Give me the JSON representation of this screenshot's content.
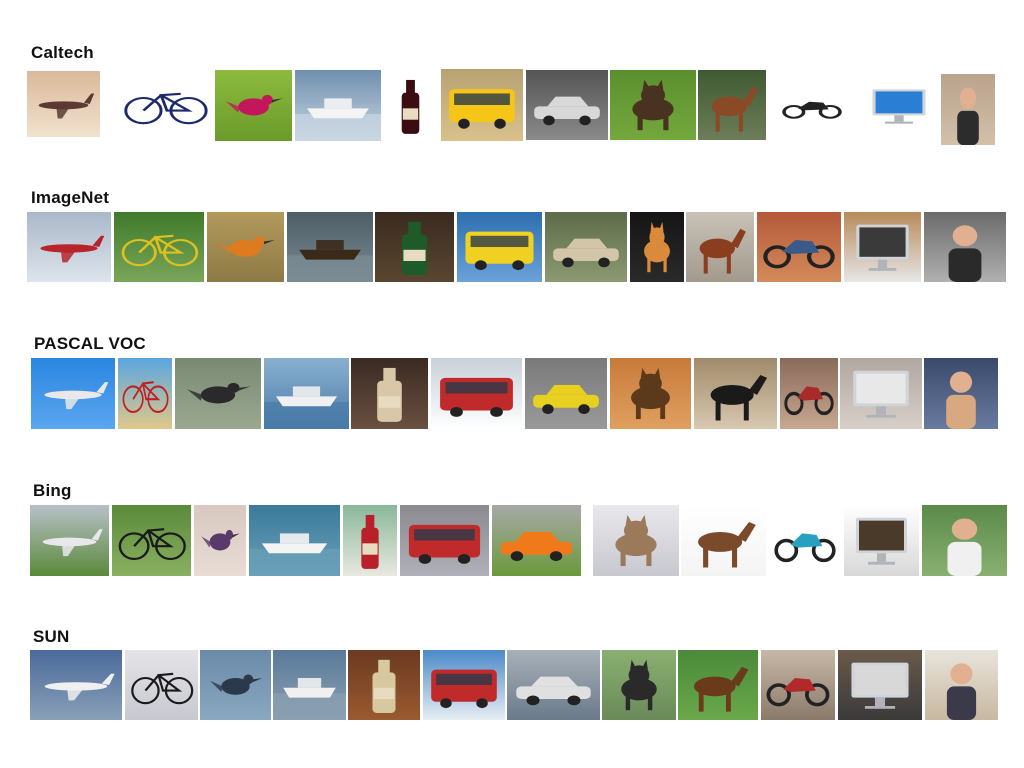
{
  "datasets": [
    {
      "name": "Caltech",
      "images": [
        {
          "subject": "airplane",
          "colors": [
            "#d9b99a",
            "#f1e2cf",
            "#5a3a32"
          ]
        },
        {
          "subject": "bicycle",
          "colors": [
            "#ffffff",
            "#ffffff",
            "#1c2a6b"
          ]
        },
        {
          "subject": "bird",
          "colors": [
            "#8dbb3e",
            "#6a9a2a",
            "#c2185b"
          ]
        },
        {
          "subject": "boat",
          "colors": [
            "#6f8fae",
            "#c9d6e2",
            "#f4f4f4"
          ]
        },
        {
          "subject": "bottle",
          "colors": [
            "#ffffff",
            "#ffffff",
            "#3b0d12"
          ]
        },
        {
          "subject": "bus",
          "colors": [
            "#b8a272",
            "#d8c18c",
            "#f5c518"
          ]
        },
        {
          "subject": "car",
          "colors": [
            "#555555",
            "#8a8a8a",
            "#d8d8d8"
          ]
        },
        {
          "subject": "dog",
          "colors": [
            "#5a8f2e",
            "#74a83d",
            "#4a3220"
          ]
        },
        {
          "subject": "horse",
          "colors": [
            "#3f5a32",
            "#6d7d58",
            "#8a4a25"
          ]
        },
        {
          "subject": "motorbike",
          "colors": [
            "#ffffff",
            "#ffffff",
            "#222222"
          ]
        },
        {
          "subject": "monitor",
          "colors": [
            "#ffffff",
            "#ffffff",
            "#2a7fd4"
          ]
        },
        {
          "subject": "person",
          "colors": [
            "#b9a38c",
            "#d2c0a8",
            "#2c2c2c"
          ]
        }
      ]
    },
    {
      "name": "ImageNet",
      "images": [
        {
          "subject": "airplane",
          "colors": [
            "#aab8c8",
            "#dde4ec",
            "#b7252b"
          ]
        },
        {
          "subject": "bicycle",
          "colors": [
            "#3f7a2a",
            "#7aa65a",
            "#e0c020"
          ]
        },
        {
          "subject": "bird",
          "colors": [
            "#b29a5c",
            "#8e7a45",
            "#e07a1e"
          ]
        },
        {
          "subject": "boat",
          "colors": [
            "#4d5d66",
            "#7c8c94",
            "#3a2a1a"
          ]
        },
        {
          "subject": "bottle",
          "colors": [
            "#3a2a20",
            "#5a4630",
            "#1e5a2a"
          ]
        },
        {
          "subject": "bus",
          "colors": [
            "#2e6fb0",
            "#6ba2d8",
            "#f0d020"
          ]
        },
        {
          "subject": "car",
          "colors": [
            "#5e6b4a",
            "#8c9a72",
            "#d2c5a8"
          ]
        },
        {
          "subject": "dog",
          "colors": [
            "#151515",
            "#2a2a2a",
            "#d98a3a"
          ]
        },
        {
          "subject": "horse",
          "colors": [
            "#c8c2b8",
            "#a29a8c",
            "#8a3e1e"
          ]
        },
        {
          "subject": "motorbike",
          "colors": [
            "#b45a3a",
            "#d48a5a",
            "#3a5a8a"
          ]
        },
        {
          "subject": "monitor",
          "colors": [
            "#b88a5a",
            "#e6e6e6",
            "#3a3a3a"
          ]
        },
        {
          "subject": "person",
          "colors": [
            "#6a6a6a",
            "#b0b0b0",
            "#2a2a2a"
          ]
        }
      ]
    },
    {
      "name": "PASCAL VOC",
      "images": [
        {
          "subject": "airplane",
          "colors": [
            "#2a86e0",
            "#5aa6f0",
            "#e8e8e8"
          ]
        },
        {
          "subject": "bicycle",
          "colors": [
            "#5aa6e0",
            "#e0c88a",
            "#c02020"
          ]
        },
        {
          "subject": "bird",
          "colors": [
            "#7a8a72",
            "#9aa890",
            "#2a2a2a"
          ]
        },
        {
          "subject": "boat",
          "colors": [
            "#8ab0d0",
            "#4a7aa8",
            "#f0f0f0"
          ]
        },
        {
          "subject": "bottle",
          "colors": [
            "#3a2a22",
            "#6a5040",
            "#d8c8a8"
          ]
        },
        {
          "subject": "bus",
          "colors": [
            "#c8d0d8",
            "#ffffff",
            "#c02a2a"
          ]
        },
        {
          "subject": "car",
          "colors": [
            "#7a7a7a",
            "#9a9a9a",
            "#e8d020"
          ]
        },
        {
          "subject": "dog",
          "colors": [
            "#c87a3a",
            "#e0a060",
            "#5a3a1a"
          ]
        },
        {
          "subject": "horse",
          "colors": [
            "#a08a6a",
            "#d8c8b0",
            "#1a1a1a"
          ]
        },
        {
          "subject": "motorbike",
          "colors": [
            "#8a6a5a",
            "#c8a890",
            "#a82a2a"
          ]
        },
        {
          "subject": "monitor",
          "colors": [
            "#b0a8a0",
            "#d8d0c8",
            "#e8e8e8"
          ]
        },
        {
          "subject": "person",
          "colors": [
            "#3a4a6a",
            "#6a7aa0",
            "#d8a880"
          ]
        }
      ]
    },
    {
      "name": "Bing",
      "images": [
        {
          "subject": "airplane",
          "colors": [
            "#b8c0c8",
            "#5a8a3a",
            "#e8e8ec"
          ]
        },
        {
          "subject": "bicycle",
          "colors": [
            "#5a8a3a",
            "#8ab060",
            "#1a1a1a"
          ]
        },
        {
          "subject": "bird",
          "colors": [
            "#d8c8c0",
            "#e8dcd4",
            "#5a3a6a"
          ]
        },
        {
          "subject": "boat",
          "colors": [
            "#3a7a9a",
            "#6aa0b8",
            "#f4f4f4"
          ]
        },
        {
          "subject": "bottle",
          "colors": [
            "#8ab89a",
            "#e8e8e0",
            "#b8202a"
          ]
        },
        {
          "subject": "bus",
          "colors": [
            "#8a8a90",
            "#b0b0b8",
            "#c02a2a"
          ]
        },
        {
          "subject": "car",
          "colors": [
            "#a8a8a8",
            "#6a9a3a",
            "#f07a1a"
          ]
        },
        {
          "subject": "dog",
          "colors": [
            "#e8e8ec",
            "#c8c8d0",
            "#9a7a5a"
          ]
        },
        {
          "subject": "horse",
          "colors": [
            "#ffffff",
            "#f4f4f4",
            "#7a4a2a"
          ]
        },
        {
          "subject": "motorbike",
          "colors": [
            "#ffffff",
            "#ffffff",
            "#2aa0c0"
          ]
        },
        {
          "subject": "monitor",
          "colors": [
            "#ffffff",
            "#d8d8d8",
            "#4a3a2a"
          ]
        },
        {
          "subject": "person",
          "colors": [
            "#5a8a4a",
            "#8ab070",
            "#f0f0f0"
          ]
        }
      ]
    },
    {
      "name": "SUN",
      "images": [
        {
          "subject": "airplane",
          "colors": [
            "#4a6a9a",
            "#8aa0b8",
            "#f0f0f0"
          ]
        },
        {
          "subject": "bicycle",
          "colors": [
            "#e4e4e8",
            "#c8c8d0",
            "#1a1a1a"
          ]
        },
        {
          "subject": "bird",
          "colors": [
            "#6a8aa8",
            "#8aa8c0",
            "#2a3a4a"
          ]
        },
        {
          "subject": "boat",
          "colors": [
            "#5a7a9a",
            "#8aa0b0",
            "#f0f0f0"
          ]
        },
        {
          "subject": "bottle",
          "colors": [
            "#6a3a22",
            "#9a5a30",
            "#d8c8a0"
          ]
        },
        {
          "subject": "bus",
          "colors": [
            "#4a8ac8",
            "#e8eef4",
            "#c02a2a"
          ]
        },
        {
          "subject": "car",
          "colors": [
            "#a8b0b8",
            "#6a7a8a",
            "#e0e0e0"
          ]
        },
        {
          "subject": "dog",
          "colors": [
            "#8ab070",
            "#6a8a5a",
            "#2a2a2a"
          ]
        },
        {
          "subject": "horse",
          "colors": [
            "#4a8a3a",
            "#6aa84a",
            "#6a3a1a"
          ]
        },
        {
          "subject": "motorbike",
          "colors": [
            "#c8b8a8",
            "#8a7a6a",
            "#b02a2a"
          ]
        },
        {
          "subject": "monitor",
          "colors": [
            "#6a5a4a",
            "#3a3a3a",
            "#d8d8d8"
          ]
        },
        {
          "subject": "person",
          "colors": [
            "#e8e4dc",
            "#c8b8a0",
            "#3a3a4a"
          ]
        }
      ]
    }
  ]
}
